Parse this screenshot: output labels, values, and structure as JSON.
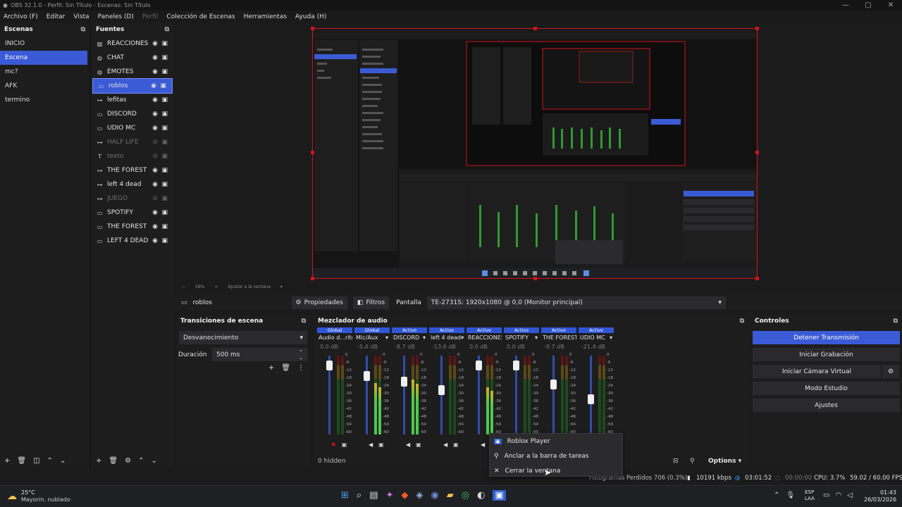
{
  "window": {
    "title": "OBS 32.1.0 - Perfil: Sin Título - Escenas: Sin Título"
  },
  "menu": [
    "Archivo (F)",
    "Editar",
    "Vista",
    "Paneles (D)",
    "Perfil",
    "Colección de Escenas",
    "Herramientas",
    "Ayuda (H)"
  ],
  "scenes": {
    "title": "Escenas",
    "items": [
      "INICIO",
      "Escena",
      "mc?",
      "AFK",
      "termino"
    ],
    "selected": "Escena"
  },
  "sources": {
    "title": "Fuentes",
    "items": [
      {
        "label": "REACCIONES",
        "icon": "image-icon",
        "visible": true,
        "selected": false
      },
      {
        "label": "CHAT",
        "icon": "browser-icon",
        "visible": true,
        "selected": false
      },
      {
        "label": "EMOTES",
        "icon": "browser-icon",
        "visible": true,
        "selected": false
      },
      {
        "label": "roblos",
        "icon": "window-icon",
        "visible": true,
        "selected": true
      },
      {
        "label": "lefitas",
        "icon": "gamepad-icon",
        "visible": true,
        "selected": false
      },
      {
        "label": "DISCORD",
        "icon": "window-icon",
        "visible": true,
        "selected": false
      },
      {
        "label": "UDIO MC",
        "icon": "window-icon",
        "visible": true,
        "selected": false
      },
      {
        "label": "HALF LIFE",
        "icon": "gamepad-icon",
        "visible": false,
        "selected": false
      },
      {
        "label": "texto",
        "icon": "text-icon",
        "visible": false,
        "selected": false
      },
      {
        "label": "THE FOREST",
        "icon": "gamepad-icon",
        "visible": true,
        "selected": false
      },
      {
        "label": "left 4 dead",
        "icon": "gamepad-icon",
        "visible": true,
        "selected": false
      },
      {
        "label": "JUEGO",
        "icon": "gamepad-icon",
        "visible": false,
        "selected": false
      },
      {
        "label": "SPOTIFY",
        "icon": "window-icon",
        "visible": true,
        "selected": false
      },
      {
        "label": "THE FOREST",
        "icon": "window-icon",
        "visible": true,
        "selected": false
      },
      {
        "label": "LEFT 4 DEAD",
        "icon": "window-icon",
        "visible": true,
        "selected": false
      }
    ]
  },
  "zoom": {
    "value": "58%",
    "fit": "Ajustar a la ventana"
  },
  "context": {
    "source": "roblos",
    "properties": "Propiedades",
    "filters": "Filtros",
    "display_label": "Pantalla",
    "display_value": "TE-2731S: 1920x1080 @ 0,0 (Monitor principal)"
  },
  "transitions": {
    "title": "Transiciones de escena",
    "type": "Desvanecimiento",
    "duration_label": "Duración",
    "duration_value": "500 ms"
  },
  "mixer": {
    "title": "Mezclador de audio",
    "hidden": "0 hidden",
    "options": "Options",
    "channels": [
      {
        "badge": "Global",
        "badge_color": "#2f56d6",
        "name": "Audio d...ritorio",
        "db": "0.0 dB",
        "fader": 0.93,
        "level": 0.0,
        "muted": true
      },
      {
        "badge": "Global",
        "badge_color": "#2f56d6",
        "name": "Mic/Aux",
        "db": "-5.4 dB",
        "fader": 0.78,
        "level": 0.65,
        "muted": false
      },
      {
        "badge": "Activo",
        "badge_color": "#2f56d6",
        "name": "DISCORD",
        "db": "-8.7 dB",
        "fader": 0.7,
        "level": 0.7,
        "muted": false
      },
      {
        "badge": "Activo",
        "badge_color": "#2f56d6",
        "name": "left 4 dead",
        "db": "-13.6 dB",
        "fader": 0.58,
        "level": 0.0,
        "muted": false
      },
      {
        "badge": "Activo",
        "badge_color": "#2f56d6",
        "name": "REACCIONES",
        "db": "0.0 dB",
        "fader": 0.93,
        "level": 0.6,
        "muted": false
      },
      {
        "badge": "Activo",
        "badge_color": "#2f56d6",
        "name": "SPOTIFY",
        "db": "0.0 dB",
        "fader": 0.93,
        "level": 0.0,
        "muted": false
      },
      {
        "badge": "Activo",
        "badge_color": "#2f56d6",
        "name": "THE FOREST",
        "db": "-9.7 dB",
        "fader": 0.66,
        "level": 0.0,
        "muted": false
      },
      {
        "badge": "Activo",
        "badge_color": "#2f56d6",
        "name": "UDIO MC",
        "db": "-21.4 dB",
        "fader": 0.45,
        "level": 0.0,
        "muted": false
      }
    ],
    "scale": [
      "0",
      "-6",
      "-12",
      "-18",
      "-24",
      "-30",
      "-36",
      "-42",
      "-48",
      "-54",
      "-60"
    ]
  },
  "controls": {
    "title": "Controles",
    "buttons": [
      "Detener Transmisión",
      "Iniciar Grabación",
      "Iniciar Cámara Virtual",
      "Modo Estudio",
      "Ajustes"
    ]
  },
  "context_menu": {
    "items": [
      "Roblox Player",
      "Anclar a la barra de tareas",
      "Cerrar la ventana"
    ]
  },
  "status": {
    "dropped": "Fotogramas Perdidos 706 (0.3%)",
    "bitrate": "10191 kbps",
    "stream_time": "03:01:52",
    "rec_time": "00:00:00",
    "cpu": "CPU: 3.7%",
    "fps": "59.02 / 60.00 FPS"
  },
  "taskbar": {
    "weather_temp": "25°C",
    "weather_desc": "Mayorm. nublado",
    "lang": "ESP",
    "lang2": "LAA",
    "time": "01:43",
    "date": "26/03/2026"
  },
  "colors": {
    "accent": "#3b5bd6",
    "preview_border": "#d0141a",
    "bg": "#1b1b1c",
    "panel": "#1d1d1e"
  }
}
